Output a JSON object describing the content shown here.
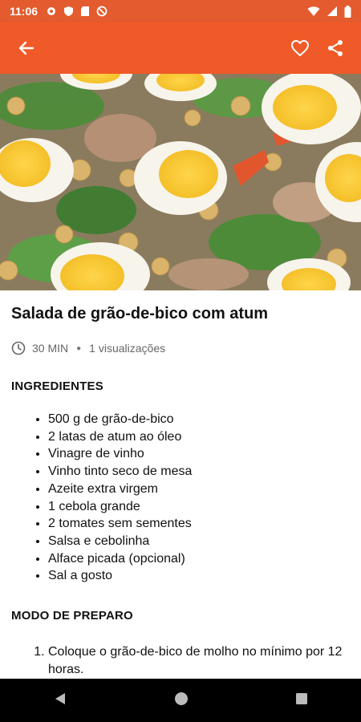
{
  "status_bar": {
    "time": "11:06",
    "icons_left": [
      "gear-icon",
      "shield-icon",
      "sd-card-icon",
      "no-sync-icon"
    ],
    "icons_right": [
      "wifi-icon",
      "signal-icon",
      "battery-icon"
    ]
  },
  "app_bar": {
    "back_icon": "back-arrow-icon",
    "favorite_icon": "heart-icon",
    "share_icon": "share-icon",
    "color": "#f05a28"
  },
  "recipe": {
    "title": "Salada de grão-de-bico com atum",
    "time": "30 MIN",
    "views": "1 visualizações",
    "ingredients_heading": "INGREDIENTES",
    "ingredients": [
      "500 g de grão-de-bico",
      "2 latas de atum ao óleo",
      "Vinagre de vinho",
      "Vinho tinto seco de mesa",
      "Azeite extra virgem",
      "1 cebola grande",
      "2 tomates sem sementes",
      "Salsa e cebolinha",
      "Alface picada (opcional)",
      "Sal a gosto"
    ],
    "preparation_heading": "MODO DE PREPARO",
    "steps": [
      "Coloque o grão-de-bico de molho no mínimo por 12 horas."
    ]
  },
  "nav_bar": {
    "back": "nav-back-icon",
    "home": "nav-home-icon",
    "recents": "nav-recents-icon"
  }
}
